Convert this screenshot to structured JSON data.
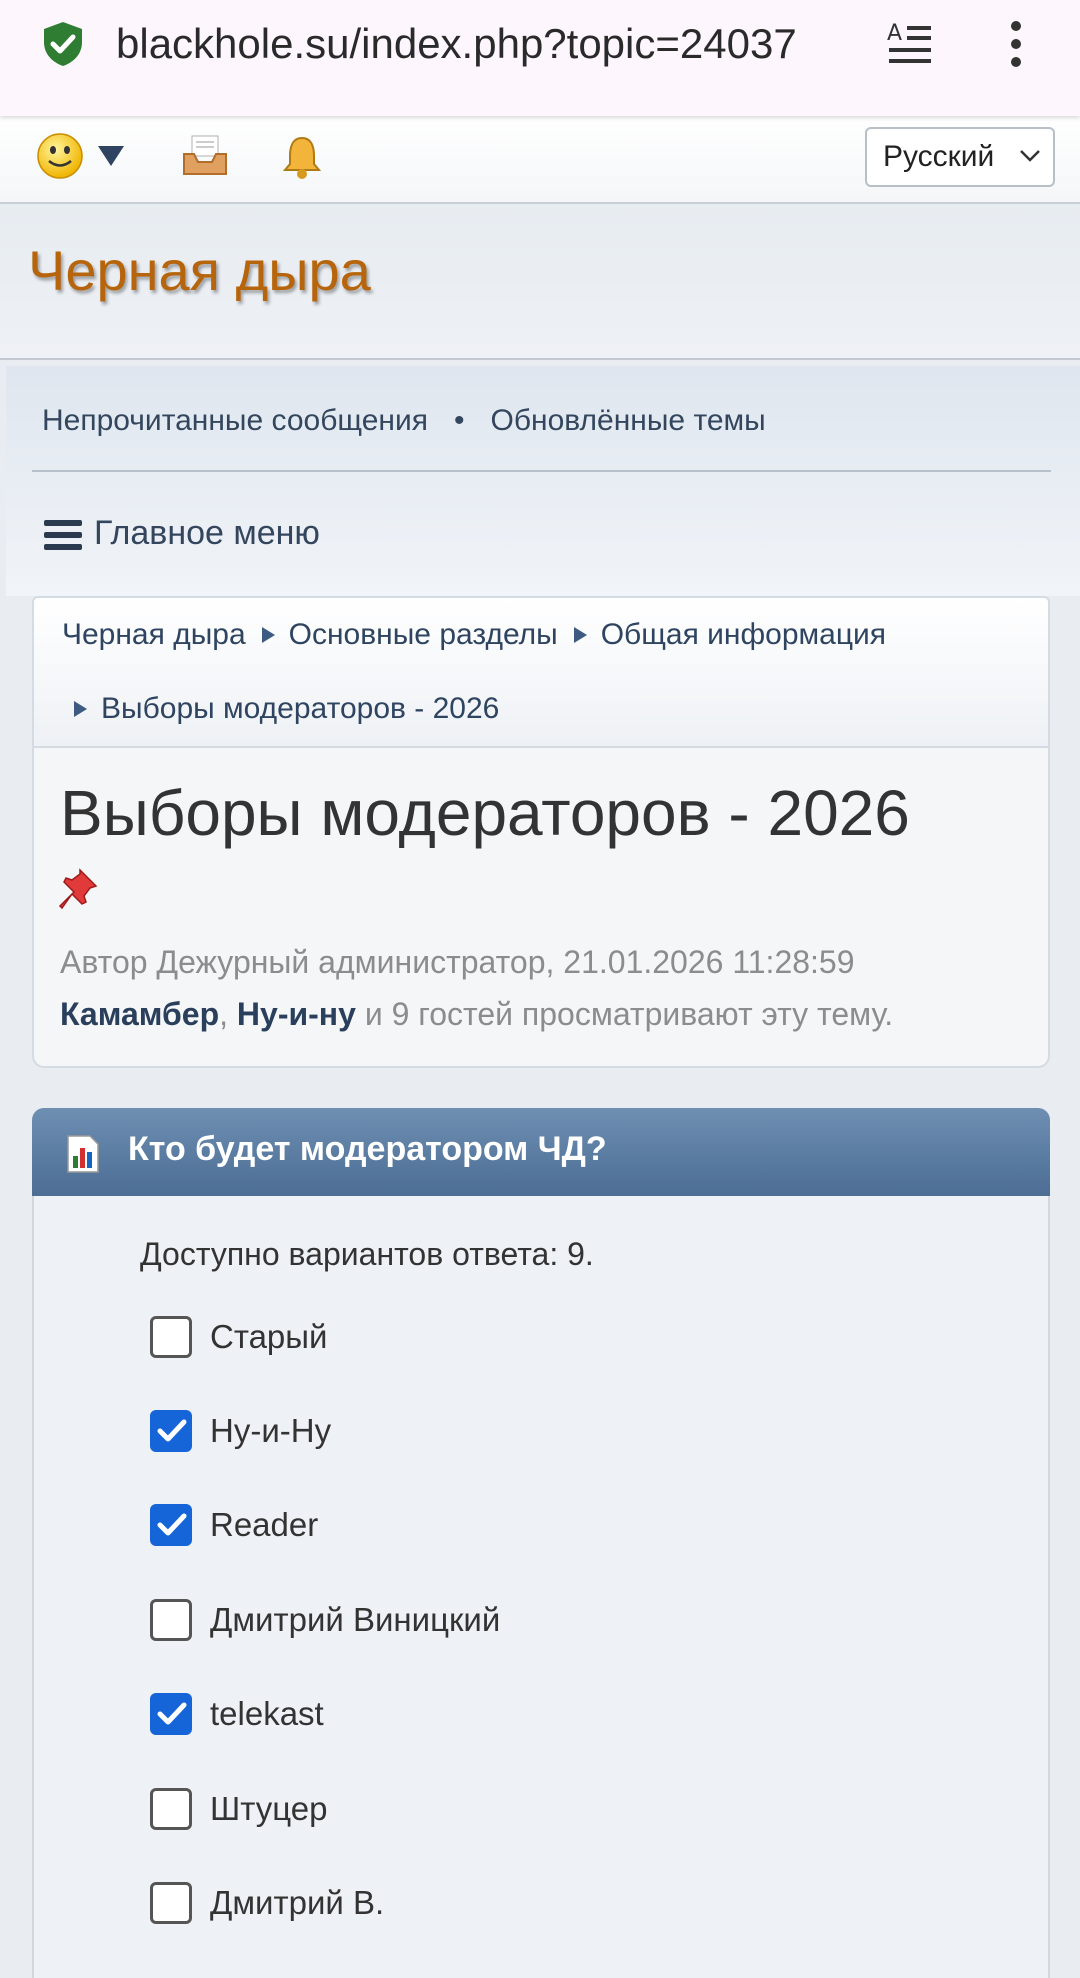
{
  "browser": {
    "url": "blackhole.su/index.php?topic=24037"
  },
  "topbar": {
    "language": "Русский"
  },
  "site": {
    "title": "Черная дыра"
  },
  "nav": {
    "unread": "Непрочитанные сообщения",
    "separator": "•",
    "updated": "Обновлённые темы",
    "main_menu": "Главное меню"
  },
  "breadcrumb": [
    "Черная дыра",
    "Основные разделы",
    "Общая информация",
    "Выборы модераторов - 2026"
  ],
  "topic": {
    "title": "Выборы модераторов - 2026",
    "author_line": "Автор Дежурный администратор, 21.01.2026 11:28:59",
    "viewer1": "Камамбер",
    "viewer_sep": ", ",
    "viewer2": "Ну-и-ну",
    "viewers_rest": " и 9 гостей просматривают эту тему."
  },
  "poll": {
    "question": "Кто будет модератором ЧД?",
    "available": "Доступно вариантов ответа: 9.",
    "options": [
      {
        "label": "Старый",
        "checked": false
      },
      {
        "label": "Ну-и-Ну",
        "checked": true
      },
      {
        "label": "Reader",
        "checked": true
      },
      {
        "label": "Дмитрий Виницкий",
        "checked": false
      },
      {
        "label": "telekast",
        "checked": true
      },
      {
        "label": "Штуцер",
        "checked": false
      },
      {
        "label": "Дмитрий В.",
        "checked": false
      }
    ]
  },
  "colors": {
    "site_title": "#b7650c",
    "poll_header": "#5a7ba2",
    "checkbox_checked": "#1565d8"
  }
}
